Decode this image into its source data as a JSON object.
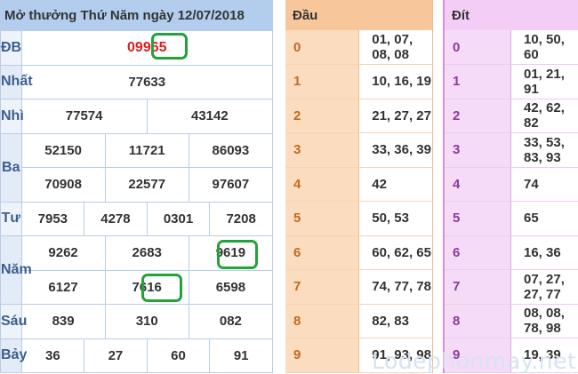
{
  "header": {
    "title": "Mở thưởng Thứ Năm ngày 12/07/2018"
  },
  "prizes": {
    "db": {
      "label": "ĐB",
      "value": "09965"
    },
    "nhat": {
      "label": "Nhất",
      "value": "77633"
    },
    "nhi": {
      "label": "Nhì",
      "values": [
        "77574",
        "43142"
      ]
    },
    "ba": {
      "label": "Ba",
      "values": [
        "52150",
        "11721",
        "86093",
        "70908",
        "22577",
        "97607"
      ]
    },
    "tu": {
      "label": "Tư",
      "values": [
        "7953",
        "4278",
        "0301",
        "7208"
      ]
    },
    "nam": {
      "label": "Năm",
      "values": [
        "9262",
        "2683",
        "9619",
        "6127",
        "7616",
        "6598"
      ]
    },
    "sau": {
      "label": "Sáu",
      "values": [
        "839",
        "310",
        "082"
      ]
    },
    "bay": {
      "label": "Bảy",
      "values": [
        "36",
        "27",
        "60",
        "91"
      ]
    }
  },
  "dau": {
    "title": "Đầu",
    "rows": [
      {
        "num": "0",
        "val": "01, 07, 08, 08"
      },
      {
        "num": "1",
        "val": "10, 16, 19"
      },
      {
        "num": "2",
        "val": "21, 27, 27"
      },
      {
        "num": "3",
        "val": "33, 36, 39"
      },
      {
        "num": "4",
        "val": "42"
      },
      {
        "num": "5",
        "val": "50, 53"
      },
      {
        "num": "6",
        "val": "60, 62, 65"
      },
      {
        "num": "7",
        "val": "74, 77, 78"
      },
      {
        "num": "8",
        "val": "82, 83"
      },
      {
        "num": "9",
        "val": "91, 93, 98"
      }
    ]
  },
  "dit": {
    "title": "Đít",
    "rows": [
      {
        "num": "0",
        "val": "10, 50, 60"
      },
      {
        "num": "1",
        "val": "01, 21, 91"
      },
      {
        "num": "2",
        "val": "42, 62, 82"
      },
      {
        "num": "3",
        "val": "33, 53, 83, 93"
      },
      {
        "num": "4",
        "val": "74"
      },
      {
        "num": "5",
        "val": "65"
      },
      {
        "num": "6",
        "val": "16, 36"
      },
      {
        "num": "7",
        "val": "07, 27, 27, 77"
      },
      {
        "num": "8",
        "val": "08, 08, 78, 98"
      },
      {
        "num": "9",
        "val": "19, 39"
      }
    ]
  },
  "watermark": "Lodephonmay.net",
  "colors": {
    "special_prize": "#e01d1d",
    "highlight": "#21a33a"
  }
}
